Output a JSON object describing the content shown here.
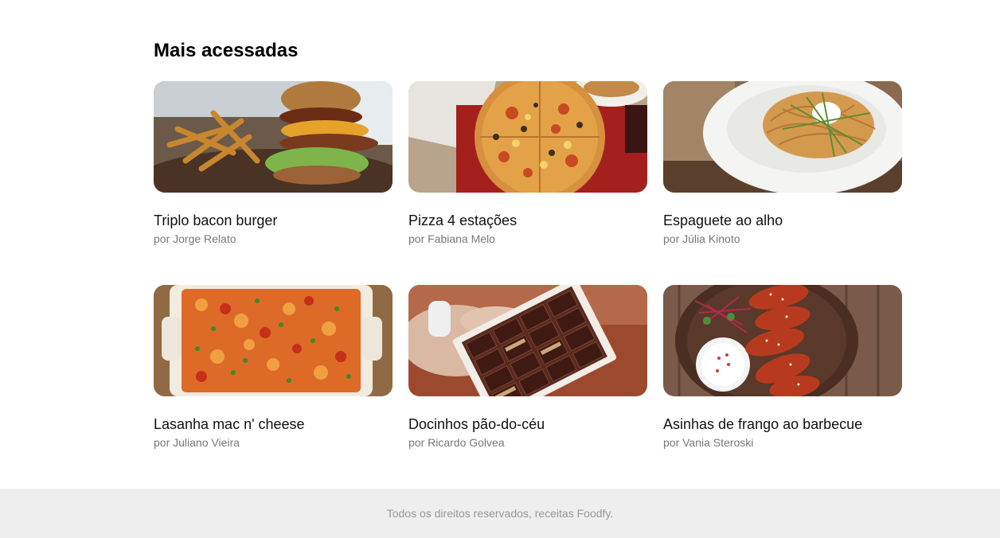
{
  "section": {
    "title": "Mais acessadas"
  },
  "recipes": [
    {
      "title": "Triplo bacon burger",
      "author": "por Jorge Relato",
      "image": "burger-photo"
    },
    {
      "title": "Pizza 4 estações",
      "author": "por Fabiana Melo",
      "image": "pizza-photo"
    },
    {
      "title": "Espaguete ao alho",
      "author": "por Júlia Kinoto",
      "image": "spaghetti-photo"
    },
    {
      "title": "Lasanha mac n' cheese",
      "author": "por Juliano Vieira",
      "image": "lasagna-photo"
    },
    {
      "title": "Docinhos pão-do-céu",
      "author": "por Ricardo Golvea",
      "image": "chocolates-photo"
    },
    {
      "title": "Asinhas de frango ao barbecue",
      "author": "por Vania Steroski",
      "image": "chicken-wings-photo"
    }
  ],
  "footer": {
    "text": "Todos os direitos reservados, receitas Foodfy."
  }
}
